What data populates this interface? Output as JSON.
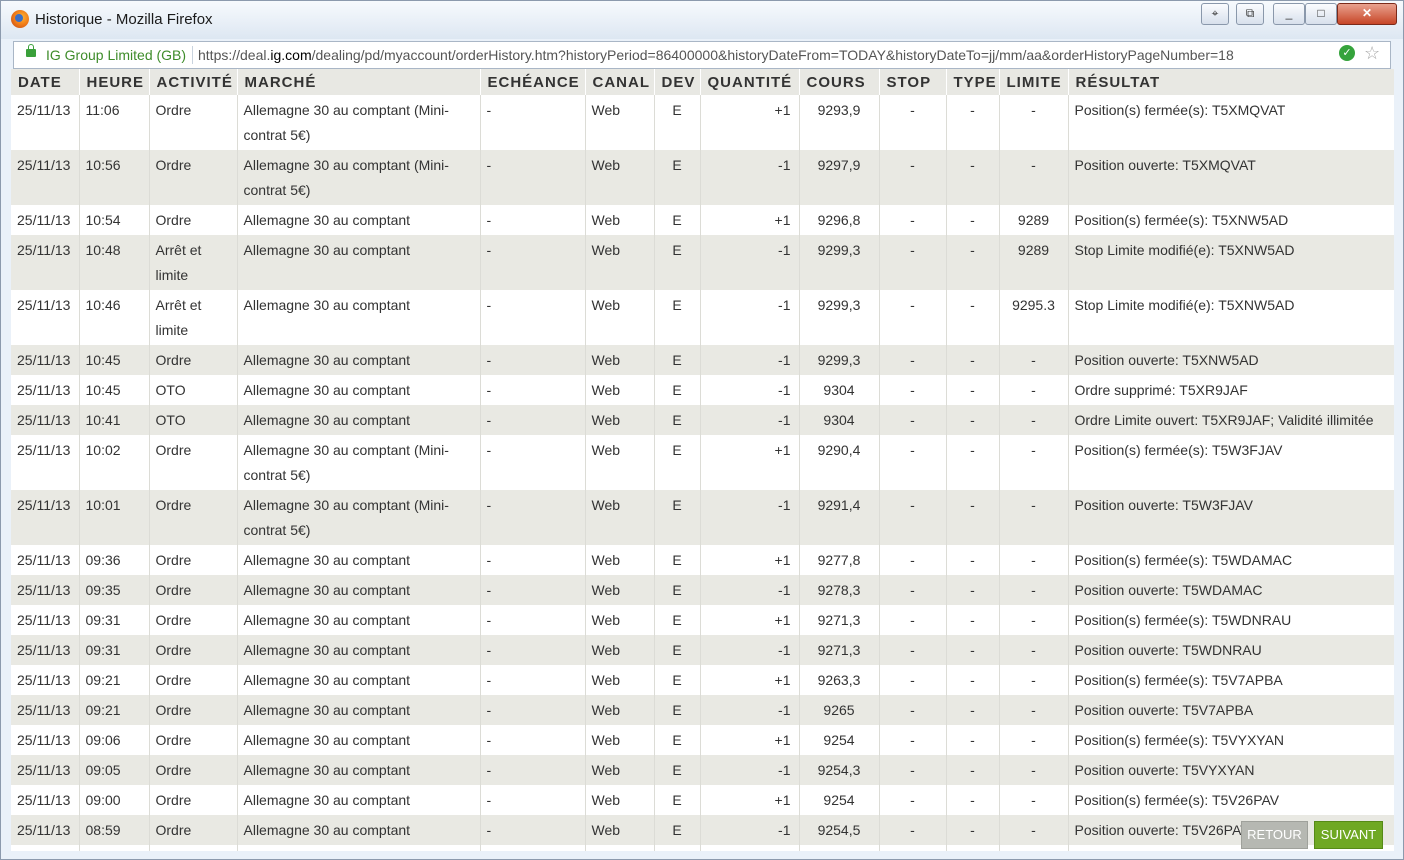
{
  "window": {
    "title": "Historique - Mozilla Firefox"
  },
  "urlbar": {
    "site_identity": "IG Group Limited (GB)",
    "url_prefix": "https://deal.",
    "url_domain": "ig.com",
    "url_rest": "/dealing/pd/myaccount/orderHistory.htm?historyPeriod=86400000&historyDateFrom=TODAY&historyDateTo=jj/mm/aa&orderHistoryPageNumber=18"
  },
  "table": {
    "headers": [
      "DATE",
      "HEURE",
      "ACTIVITÉ",
      "MARCHÉ",
      "ECHÉANCE",
      "CANAL",
      "DEV",
      "QUANTITÉ",
      "COURS",
      "STOP",
      "TYPE",
      "LIMITE",
      "RÉSULTAT"
    ],
    "rows": [
      [
        "25/11/13",
        "11:06",
        "Ordre",
        "Allemagne 30 au comptant (Mini-contrat 5€)",
        "-",
        "Web",
        "E",
        "+1",
        "9293,9",
        "-",
        "-",
        "-",
        "Position(s) fermée(s): T5XMQVAT"
      ],
      [
        "25/11/13",
        "10:56",
        "Ordre",
        "Allemagne 30 au comptant (Mini-contrat 5€)",
        "-",
        "Web",
        "E",
        "-1",
        "9297,9",
        "-",
        "-",
        "-",
        "Position ouverte: T5XMQVAT"
      ],
      [
        "25/11/13",
        "10:54",
        "Ordre",
        "Allemagne 30 au comptant",
        "-",
        "Web",
        "E",
        "+1",
        "9296,8",
        "-",
        "-",
        "9289",
        "Position(s) fermée(s): T5XNW5AD"
      ],
      [
        "25/11/13",
        "10:48",
        "Arrêt et limite",
        "Allemagne 30 au comptant",
        "-",
        "Web",
        "E",
        "-1",
        "9299,3",
        "-",
        "-",
        "9289",
        "Stop Limite modifié(e): T5XNW5AD"
      ],
      [
        "25/11/13",
        "10:46",
        "Arrêt et limite",
        "Allemagne 30 au comptant",
        "-",
        "Web",
        "E",
        "-1",
        "9299,3",
        "-",
        "-",
        "9295.3",
        "Stop Limite modifié(e): T5XNW5AD"
      ],
      [
        "25/11/13",
        "10:45",
        "Ordre",
        "Allemagne 30 au comptant",
        "-",
        "Web",
        "E",
        "-1",
        "9299,3",
        "-",
        "-",
        "-",
        "Position ouverte: T5XNW5AD"
      ],
      [
        "25/11/13",
        "10:45",
        "OTO",
        "Allemagne 30 au comptant",
        "-",
        "Web",
        "E",
        "-1",
        "9304",
        "-",
        "-",
        "-",
        "Ordre supprimé: T5XR9JAF"
      ],
      [
        "25/11/13",
        "10:41",
        "OTO",
        "Allemagne 30 au comptant",
        "-",
        "Web",
        "E",
        "-1",
        "9304",
        "-",
        "-",
        "-",
        "Ordre Limite ouvert: T5XR9JAF; Validité illimitée"
      ],
      [
        "25/11/13",
        "10:02",
        "Ordre",
        "Allemagne 30 au comptant (Mini-contrat 5€)",
        "-",
        "Web",
        "E",
        "+1",
        "9290,4",
        "-",
        "-",
        "-",
        "Position(s) fermée(s): T5W3FJAV"
      ],
      [
        "25/11/13",
        "10:01",
        "Ordre",
        "Allemagne 30 au comptant (Mini-contrat 5€)",
        "-",
        "Web",
        "E",
        "-1",
        "9291,4",
        "-",
        "-",
        "-",
        "Position ouverte: T5W3FJAV"
      ],
      [
        "25/11/13",
        "09:36",
        "Ordre",
        "Allemagne 30 au comptant",
        "-",
        "Web",
        "E",
        "+1",
        "9277,8",
        "-",
        "-",
        "-",
        "Position(s) fermée(s): T5WDAMAC"
      ],
      [
        "25/11/13",
        "09:35",
        "Ordre",
        "Allemagne 30 au comptant",
        "-",
        "Web",
        "E",
        "-1",
        "9278,3",
        "-",
        "-",
        "-",
        "Position ouverte: T5WDAMAC"
      ],
      [
        "25/11/13",
        "09:31",
        "Ordre",
        "Allemagne 30 au comptant",
        "-",
        "Web",
        "E",
        "+1",
        "9271,3",
        "-",
        "-",
        "-",
        "Position(s) fermée(s): T5WDNRAU"
      ],
      [
        "25/11/13",
        "09:31",
        "Ordre",
        "Allemagne 30 au comptant",
        "-",
        "Web",
        "E",
        "-1",
        "9271,3",
        "-",
        "-",
        "-",
        "Position ouverte: T5WDNRAU"
      ],
      [
        "25/11/13",
        "09:21",
        "Ordre",
        "Allemagne 30 au comptant",
        "-",
        "Web",
        "E",
        "+1",
        "9263,3",
        "-",
        "-",
        "-",
        "Position(s) fermée(s): T5V7APBA"
      ],
      [
        "25/11/13",
        "09:21",
        "Ordre",
        "Allemagne 30 au comptant",
        "-",
        "Web",
        "E",
        "-1",
        "9265",
        "-",
        "-",
        "-",
        "Position ouverte: T5V7APBA"
      ],
      [
        "25/11/13",
        "09:06",
        "Ordre",
        "Allemagne 30 au comptant",
        "-",
        "Web",
        "E",
        "+1",
        "9254",
        "-",
        "-",
        "-",
        "Position(s) fermée(s): T5VYXYAN"
      ],
      [
        "25/11/13",
        "09:05",
        "Ordre",
        "Allemagne 30 au comptant",
        "-",
        "Web",
        "E",
        "-1",
        "9254,3",
        "-",
        "-",
        "-",
        "Position ouverte: T5VYXYAN"
      ],
      [
        "25/11/13",
        "09:00",
        "Ordre",
        "Allemagne 30 au comptant",
        "-",
        "Web",
        "E",
        "+1",
        "9254",
        "-",
        "-",
        "-",
        "Position(s) fermée(s): T5V26PAV"
      ],
      [
        "25/11/13",
        "08:59",
        "Ordre",
        "Allemagne 30 au comptant",
        "-",
        "Web",
        "E",
        "-1",
        "9254,5",
        "-",
        "-",
        "-",
        "Position ouverte: T5V26PAV"
      ]
    ]
  },
  "buttons": {
    "back": "RETOUR",
    "next": "SUIVANT"
  },
  "colors": {
    "accent_green": "#6fa823",
    "row_alt": "#e9e9e3",
    "site_identity": "#3e8c2a"
  }
}
